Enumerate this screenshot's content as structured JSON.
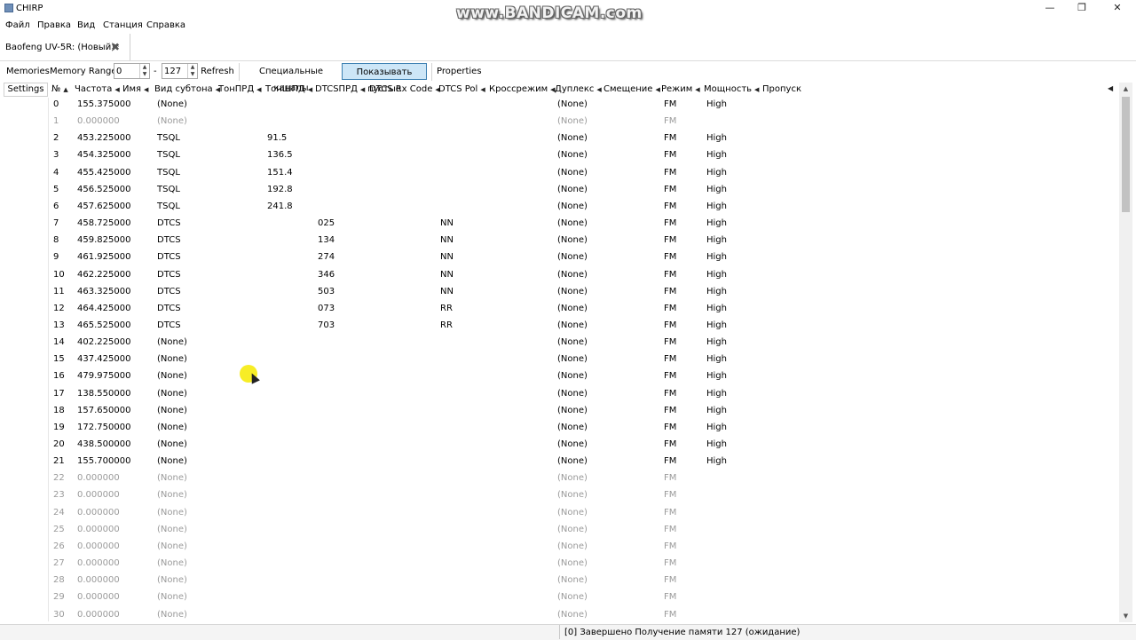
{
  "window": {
    "title": "CHIRP",
    "minimize": "—",
    "maximize": "❐",
    "close": "✕"
  },
  "watermark": "www.BANDICAM.com",
  "menu": [
    "Файл",
    "Правка",
    "Вид",
    "Станция",
    "Справка"
  ],
  "tab": {
    "label": "Baofeng UV-5R: (Новый)*",
    "close": "✖"
  },
  "toolbar": {
    "memories_label": "Memories",
    "range_label": "Memory Range:",
    "range_from": "0",
    "range_sep": "-",
    "range_to": "127",
    "refresh": "Refresh",
    "special_channels": "Специальные каналы",
    "show_empty": "Показывать пустые",
    "properties": "Properties"
  },
  "settings_label": "Settings",
  "columns": [
    "№",
    "Частота",
    "Имя",
    "Вид субтона",
    "ТонПРД",
    "ТонШПД",
    "DTCSПРД",
    "DTCS Rx Code",
    "DTCS Pol",
    "Кроссрежим",
    "Дуплекс",
    "Смещение",
    "Режим",
    "Мощность",
    "Пропуск"
  ],
  "rows": [
    {
      "num": "0",
      "freq": "155.375000",
      "tone_mode": "(None)",
      "rtone": "",
      "dtcs": "",
      "pol": "",
      "duplex": "(None)",
      "mode": "FM",
      "power": "High",
      "empty": false
    },
    {
      "num": "1",
      "freq": "0.000000",
      "tone_mode": "(None)",
      "rtone": "",
      "dtcs": "",
      "pol": "",
      "duplex": "(None)",
      "mode": "FM",
      "power": "",
      "empty": true
    },
    {
      "num": "2",
      "freq": "453.225000",
      "tone_mode": "TSQL",
      "rtone": "91.5",
      "dtcs": "",
      "pol": "",
      "duplex": "(None)",
      "mode": "FM",
      "power": "High",
      "empty": false
    },
    {
      "num": "3",
      "freq": "454.325000",
      "tone_mode": "TSQL",
      "rtone": "136.5",
      "dtcs": "",
      "pol": "",
      "duplex": "(None)",
      "mode": "FM",
      "power": "High",
      "empty": false
    },
    {
      "num": "4",
      "freq": "455.425000",
      "tone_mode": "TSQL",
      "rtone": "151.4",
      "dtcs": "",
      "pol": "",
      "duplex": "(None)",
      "mode": "FM",
      "power": "High",
      "empty": false
    },
    {
      "num": "5",
      "freq": "456.525000",
      "tone_mode": "TSQL",
      "rtone": "192.8",
      "dtcs": "",
      "pol": "",
      "duplex": "(None)",
      "mode": "FM",
      "power": "High",
      "empty": false
    },
    {
      "num": "6",
      "freq": "457.625000",
      "tone_mode": "TSQL",
      "rtone": "241.8",
      "dtcs": "",
      "pol": "",
      "duplex": "(None)",
      "mode": "FM",
      "power": "High",
      "empty": false
    },
    {
      "num": "7",
      "freq": "458.725000",
      "tone_mode": "DTCS",
      "rtone": "",
      "dtcs": "025",
      "pol": "NN",
      "duplex": "(None)",
      "mode": "FM",
      "power": "High",
      "empty": false
    },
    {
      "num": "8",
      "freq": "459.825000",
      "tone_mode": "DTCS",
      "rtone": "",
      "dtcs": "134",
      "pol": "NN",
      "duplex": "(None)",
      "mode": "FM",
      "power": "High",
      "empty": false
    },
    {
      "num": "9",
      "freq": "461.925000",
      "tone_mode": "DTCS",
      "rtone": "",
      "dtcs": "274",
      "pol": "NN",
      "duplex": "(None)",
      "mode": "FM",
      "power": "High",
      "empty": false
    },
    {
      "num": "10",
      "freq": "462.225000",
      "tone_mode": "DTCS",
      "rtone": "",
      "dtcs": "346",
      "pol": "NN",
      "duplex": "(None)",
      "mode": "FM",
      "power": "High",
      "empty": false
    },
    {
      "num": "11",
      "freq": "463.325000",
      "tone_mode": "DTCS",
      "rtone": "",
      "dtcs": "503",
      "pol": "NN",
      "duplex": "(None)",
      "mode": "FM",
      "power": "High",
      "empty": false
    },
    {
      "num": "12",
      "freq": "464.425000",
      "tone_mode": "DTCS",
      "rtone": "",
      "dtcs": "073",
      "pol": "RR",
      "duplex": "(None)",
      "mode": "FM",
      "power": "High",
      "empty": false
    },
    {
      "num": "13",
      "freq": "465.525000",
      "tone_mode": "DTCS",
      "rtone": "",
      "dtcs": "703",
      "pol": "RR",
      "duplex": "(None)",
      "mode": "FM",
      "power": "High",
      "empty": false
    },
    {
      "num": "14",
      "freq": "402.225000",
      "tone_mode": "(None)",
      "rtone": "",
      "dtcs": "",
      "pol": "",
      "duplex": "(None)",
      "mode": "FM",
      "power": "High",
      "empty": false
    },
    {
      "num": "15",
      "freq": "437.425000",
      "tone_mode": "(None)",
      "rtone": "",
      "dtcs": "",
      "pol": "",
      "duplex": "(None)",
      "mode": "FM",
      "power": "High",
      "empty": false
    },
    {
      "num": "16",
      "freq": "479.975000",
      "tone_mode": "(None)",
      "rtone": "",
      "dtcs": "",
      "pol": "",
      "duplex": "(None)",
      "mode": "FM",
      "power": "High",
      "empty": false
    },
    {
      "num": "17",
      "freq": "138.550000",
      "tone_mode": "(None)",
      "rtone": "",
      "dtcs": "",
      "pol": "",
      "duplex": "(None)",
      "mode": "FM",
      "power": "High",
      "empty": false
    },
    {
      "num": "18",
      "freq": "157.650000",
      "tone_mode": "(None)",
      "rtone": "",
      "dtcs": "",
      "pol": "",
      "duplex": "(None)",
      "mode": "FM",
      "power": "High",
      "empty": false
    },
    {
      "num": "19",
      "freq": "172.750000",
      "tone_mode": "(None)",
      "rtone": "",
      "dtcs": "",
      "pol": "",
      "duplex": "(None)",
      "mode": "FM",
      "power": "High",
      "empty": false
    },
    {
      "num": "20",
      "freq": "438.500000",
      "tone_mode": "(None)",
      "rtone": "",
      "dtcs": "",
      "pol": "",
      "duplex": "(None)",
      "mode": "FM",
      "power": "High",
      "empty": false
    },
    {
      "num": "21",
      "freq": "155.700000",
      "tone_mode": "(None)",
      "rtone": "",
      "dtcs": "",
      "pol": "",
      "duplex": "(None)",
      "mode": "FM",
      "power": "High",
      "empty": false
    },
    {
      "num": "22",
      "freq": "0.000000",
      "tone_mode": "(None)",
      "rtone": "",
      "dtcs": "",
      "pol": "",
      "duplex": "(None)",
      "mode": "FM",
      "power": "",
      "empty": true
    },
    {
      "num": "23",
      "freq": "0.000000",
      "tone_mode": "(None)",
      "rtone": "",
      "dtcs": "",
      "pol": "",
      "duplex": "(None)",
      "mode": "FM",
      "power": "",
      "empty": true
    },
    {
      "num": "24",
      "freq": "0.000000",
      "tone_mode": "(None)",
      "rtone": "",
      "dtcs": "",
      "pol": "",
      "duplex": "(None)",
      "mode": "FM",
      "power": "",
      "empty": true
    },
    {
      "num": "25",
      "freq": "0.000000",
      "tone_mode": "(None)",
      "rtone": "",
      "dtcs": "",
      "pol": "",
      "duplex": "(None)",
      "mode": "FM",
      "power": "",
      "empty": true
    },
    {
      "num": "26",
      "freq": "0.000000",
      "tone_mode": "(None)",
      "rtone": "",
      "dtcs": "",
      "pol": "",
      "duplex": "(None)",
      "mode": "FM",
      "power": "",
      "empty": true
    },
    {
      "num": "27",
      "freq": "0.000000",
      "tone_mode": "(None)",
      "rtone": "",
      "dtcs": "",
      "pol": "",
      "duplex": "(None)",
      "mode": "FM",
      "power": "",
      "empty": true
    },
    {
      "num": "28",
      "freq": "0.000000",
      "tone_mode": "(None)",
      "rtone": "",
      "dtcs": "",
      "pol": "",
      "duplex": "(None)",
      "mode": "FM",
      "power": "",
      "empty": true
    },
    {
      "num": "29",
      "freq": "0.000000",
      "tone_mode": "(None)",
      "rtone": "",
      "dtcs": "",
      "pol": "",
      "duplex": "(None)",
      "mode": "FM",
      "power": "",
      "empty": true
    },
    {
      "num": "30",
      "freq": "0.000000",
      "tone_mode": "(None)",
      "rtone": "",
      "dtcs": "",
      "pol": "",
      "duplex": "(None)",
      "mode": "FM",
      "power": "",
      "empty": true
    }
  ],
  "status": "[0] Завершено Получение памяти 127 (ожидание)",
  "colors": {
    "active_button_bg": "#cde6f7",
    "active_button_border": "#3c7fb1",
    "empty_row_text": "#9a9a9a",
    "cursor_highlight": "#f6ea00"
  }
}
